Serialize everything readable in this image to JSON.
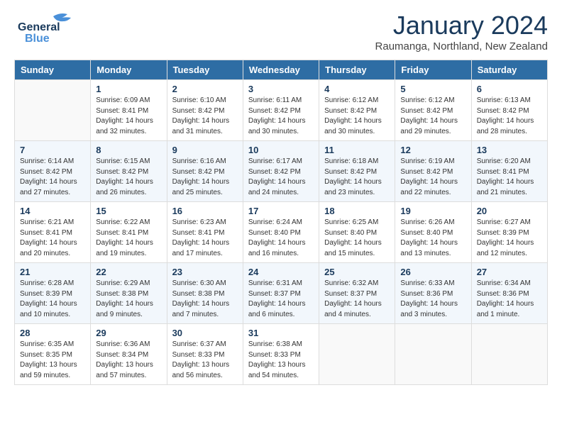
{
  "header": {
    "logo_line1": "General",
    "logo_line2": "Blue",
    "month_title": "January 2024",
    "location": "Raumanga, Northland, New Zealand"
  },
  "weekdays": [
    "Sunday",
    "Monday",
    "Tuesday",
    "Wednesday",
    "Thursday",
    "Friday",
    "Saturday"
  ],
  "weeks": [
    [
      {
        "num": "",
        "info": ""
      },
      {
        "num": "1",
        "info": "Sunrise: 6:09 AM\nSunset: 8:41 PM\nDaylight: 14 hours\nand 32 minutes."
      },
      {
        "num": "2",
        "info": "Sunrise: 6:10 AM\nSunset: 8:42 PM\nDaylight: 14 hours\nand 31 minutes."
      },
      {
        "num": "3",
        "info": "Sunrise: 6:11 AM\nSunset: 8:42 PM\nDaylight: 14 hours\nand 30 minutes."
      },
      {
        "num": "4",
        "info": "Sunrise: 6:12 AM\nSunset: 8:42 PM\nDaylight: 14 hours\nand 30 minutes."
      },
      {
        "num": "5",
        "info": "Sunrise: 6:12 AM\nSunset: 8:42 PM\nDaylight: 14 hours\nand 29 minutes."
      },
      {
        "num": "6",
        "info": "Sunrise: 6:13 AM\nSunset: 8:42 PM\nDaylight: 14 hours\nand 28 minutes."
      }
    ],
    [
      {
        "num": "7",
        "info": "Sunrise: 6:14 AM\nSunset: 8:42 PM\nDaylight: 14 hours\nand 27 minutes."
      },
      {
        "num": "8",
        "info": "Sunrise: 6:15 AM\nSunset: 8:42 PM\nDaylight: 14 hours\nand 26 minutes."
      },
      {
        "num": "9",
        "info": "Sunrise: 6:16 AM\nSunset: 8:42 PM\nDaylight: 14 hours\nand 25 minutes."
      },
      {
        "num": "10",
        "info": "Sunrise: 6:17 AM\nSunset: 8:42 PM\nDaylight: 14 hours\nand 24 minutes."
      },
      {
        "num": "11",
        "info": "Sunrise: 6:18 AM\nSunset: 8:42 PM\nDaylight: 14 hours\nand 23 minutes."
      },
      {
        "num": "12",
        "info": "Sunrise: 6:19 AM\nSunset: 8:42 PM\nDaylight: 14 hours\nand 22 minutes."
      },
      {
        "num": "13",
        "info": "Sunrise: 6:20 AM\nSunset: 8:41 PM\nDaylight: 14 hours\nand 21 minutes."
      }
    ],
    [
      {
        "num": "14",
        "info": "Sunrise: 6:21 AM\nSunset: 8:41 PM\nDaylight: 14 hours\nand 20 minutes."
      },
      {
        "num": "15",
        "info": "Sunrise: 6:22 AM\nSunset: 8:41 PM\nDaylight: 14 hours\nand 19 minutes."
      },
      {
        "num": "16",
        "info": "Sunrise: 6:23 AM\nSunset: 8:41 PM\nDaylight: 14 hours\nand 17 minutes."
      },
      {
        "num": "17",
        "info": "Sunrise: 6:24 AM\nSunset: 8:40 PM\nDaylight: 14 hours\nand 16 minutes."
      },
      {
        "num": "18",
        "info": "Sunrise: 6:25 AM\nSunset: 8:40 PM\nDaylight: 14 hours\nand 15 minutes."
      },
      {
        "num": "19",
        "info": "Sunrise: 6:26 AM\nSunset: 8:40 PM\nDaylight: 14 hours\nand 13 minutes."
      },
      {
        "num": "20",
        "info": "Sunrise: 6:27 AM\nSunset: 8:39 PM\nDaylight: 14 hours\nand 12 minutes."
      }
    ],
    [
      {
        "num": "21",
        "info": "Sunrise: 6:28 AM\nSunset: 8:39 PM\nDaylight: 14 hours\nand 10 minutes."
      },
      {
        "num": "22",
        "info": "Sunrise: 6:29 AM\nSunset: 8:38 PM\nDaylight: 14 hours\nand 9 minutes."
      },
      {
        "num": "23",
        "info": "Sunrise: 6:30 AM\nSunset: 8:38 PM\nDaylight: 14 hours\nand 7 minutes."
      },
      {
        "num": "24",
        "info": "Sunrise: 6:31 AM\nSunset: 8:37 PM\nDaylight: 14 hours\nand 6 minutes."
      },
      {
        "num": "25",
        "info": "Sunrise: 6:32 AM\nSunset: 8:37 PM\nDaylight: 14 hours\nand 4 minutes."
      },
      {
        "num": "26",
        "info": "Sunrise: 6:33 AM\nSunset: 8:36 PM\nDaylight: 14 hours\nand 3 minutes."
      },
      {
        "num": "27",
        "info": "Sunrise: 6:34 AM\nSunset: 8:36 PM\nDaylight: 14 hours\nand 1 minute."
      }
    ],
    [
      {
        "num": "28",
        "info": "Sunrise: 6:35 AM\nSunset: 8:35 PM\nDaylight: 13 hours\nand 59 minutes."
      },
      {
        "num": "29",
        "info": "Sunrise: 6:36 AM\nSunset: 8:34 PM\nDaylight: 13 hours\nand 57 minutes."
      },
      {
        "num": "30",
        "info": "Sunrise: 6:37 AM\nSunset: 8:33 PM\nDaylight: 13 hours\nand 56 minutes."
      },
      {
        "num": "31",
        "info": "Sunrise: 6:38 AM\nSunset: 8:33 PM\nDaylight: 13 hours\nand 54 minutes."
      },
      {
        "num": "",
        "info": ""
      },
      {
        "num": "",
        "info": ""
      },
      {
        "num": "",
        "info": ""
      }
    ]
  ]
}
